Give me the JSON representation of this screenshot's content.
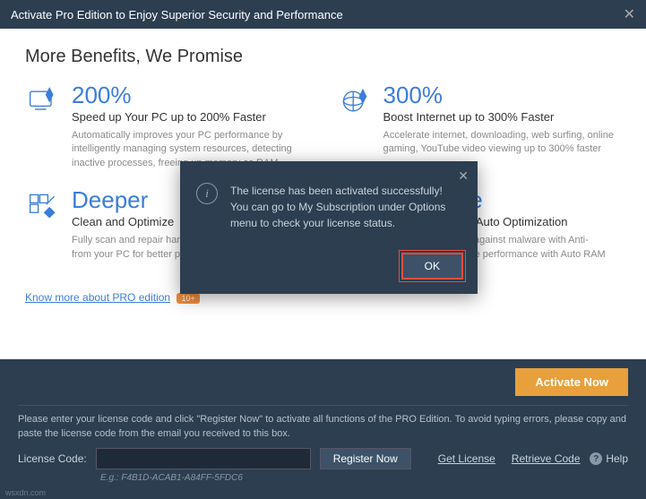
{
  "titlebar": {
    "title": "Activate Pro Edition to Enjoy Superior Security and Performance"
  },
  "heading": "More Benefits, We Promise",
  "cards": [
    {
      "title": "200%",
      "subtitle": "Speed up Your PC up to 200% Faster",
      "desc": "Automatically improves your PC performance by intelligently managing system resources, detecting inactive processes, freeing up memory as RAM"
    },
    {
      "title": "300%",
      "subtitle": "Boost Internet up to 300% Faster",
      "desc": "Accelerate internet, downloading, web surfing, online gaming, YouTube video viewing up to 300% faster"
    },
    {
      "title": "Deeper",
      "subtitle": "Clean and Optimize",
      "desc": "Fully scan and repair hard drive, removing junk files from your PC for better performance"
    },
    {
      "title": "Real-time",
      "subtitle": "Safer Browsing & Auto Optimization",
      "desc": "Real-time protection against malware with Anti-Spyware and optimize performance with Auto RAM Clean in real time"
    }
  ],
  "knowmore": {
    "text": "Know more about PRO edition",
    "badge": "10+"
  },
  "footer": {
    "activate": "Activate Now",
    "desc": "Please enter your license code and click \"Register Now\" to activate all functions of the PRO Edition. To avoid typing errors, please copy and paste the license code from the email you received to this box.",
    "license_label": "License Code:",
    "register": "Register Now",
    "get_license": "Get License",
    "retrieve": "Retrieve Code",
    "help": "Help",
    "example": "E.g.: F4B1D-ACAB1-A84FF-5FDC6"
  },
  "modal": {
    "line1": "The license has been activated successfully!",
    "line2": "You can go to My Subscription under Options menu to check your license status.",
    "ok": "OK"
  },
  "watermark": "wsxdn.com"
}
